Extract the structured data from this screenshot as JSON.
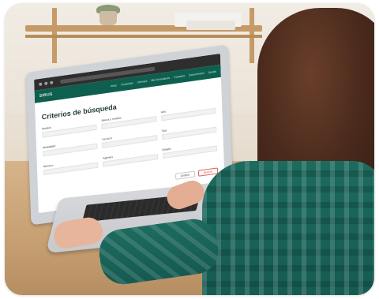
{
  "scene": {
    "caption": "",
    "subject": "woman-using-laptop",
    "colors": {
      "shirt": "#1d6b5f",
      "laptop_nav": "#0f5f4f",
      "table": "#c69f72"
    }
  },
  "laptop_screen": {
    "brand": "SIRUS",
    "menu": [
      "Inicio",
      "Consultas",
      "Clientes",
      "Mis formularios",
      "Contacto",
      "Documentos",
      "Ayuda"
    ],
    "title": "Criterios de búsqueda",
    "subtitle": "",
    "fields": [
      {
        "label": "Modelo"
      },
      {
        "label": "Marca o modelo"
      },
      {
        "label": "Año"
      },
      {
        "label": "Modalidad"
      },
      {
        "label": "Servicio"
      },
      {
        "label": "Tipo"
      },
      {
        "label": "Número"
      },
      {
        "label": "Agentes"
      },
      {
        "label": "Estado"
      }
    ],
    "buttons": [
      "Limpiar",
      "Buscar"
    ]
  }
}
